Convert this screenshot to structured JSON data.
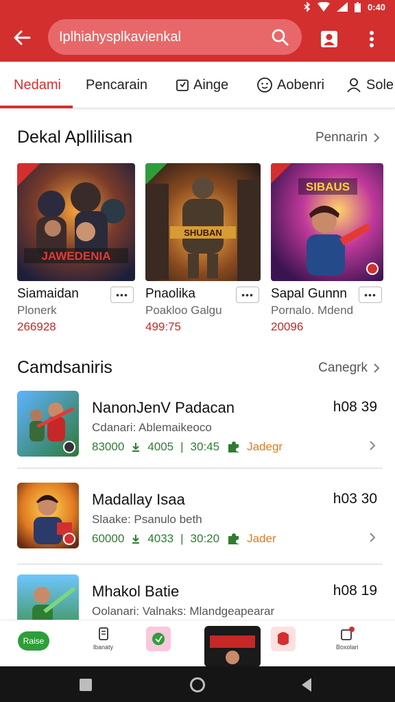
{
  "status": {
    "time": "0:40"
  },
  "appbar": {
    "search_text": "Iplhiahysplkavienkal"
  },
  "tabs": [
    {
      "label": "Nedami",
      "active": true
    },
    {
      "label": "Pencarain",
      "active": false
    },
    {
      "label": "Ainge",
      "active": false
    },
    {
      "label": "Aobenri",
      "active": false
    },
    {
      "label": "Sole",
      "active": false
    }
  ],
  "featured": {
    "title": "Dekal Apllilisan",
    "link": "Pennarin",
    "items": [
      {
        "name": "Siamaidan",
        "sub": "Plonerk",
        "count": "266928",
        "art_text": "JAWEDENIA"
      },
      {
        "name": "Pnaolika",
        "sub": "Poakloo Galgu",
        "count": "499:75",
        "art_text": "SHUBAN"
      },
      {
        "name": "Sapal Gunnn",
        "sub": "Pornalo. Mdend",
        "count": "20096",
        "art_text": "SIBAUS"
      }
    ]
  },
  "list": {
    "title": "Camdsaniris",
    "link": "Canegrk",
    "items": [
      {
        "title": "NanonJenV Padacan",
        "desc": "Cdanari: Ablemaikeoco",
        "time": "h08 39",
        "price": "83000",
        "stat1": "4005",
        "stat2": "30:45",
        "tag": "Jadegr"
      },
      {
        "title": "Madallay Isaa",
        "desc": "Slaake: Psanulo beth",
        "time": "h03 30",
        "price": "60000",
        "stat1": "4033",
        "stat2": "30:20",
        "tag": "Jader"
      },
      {
        "title": "Mhakol Batie",
        "desc": "Oolanari: Valnaks: Mlandgeapearar",
        "time": "h08 19"
      }
    ]
  },
  "dock": {
    "pill_label": "Raise",
    "items": [
      "lbanaty",
      "",
      "",
      "",
      "Boxolari"
    ]
  },
  "colors": {
    "brand": "#d32f2f",
    "green": "#2e7d32",
    "orange": "#e07b22"
  }
}
